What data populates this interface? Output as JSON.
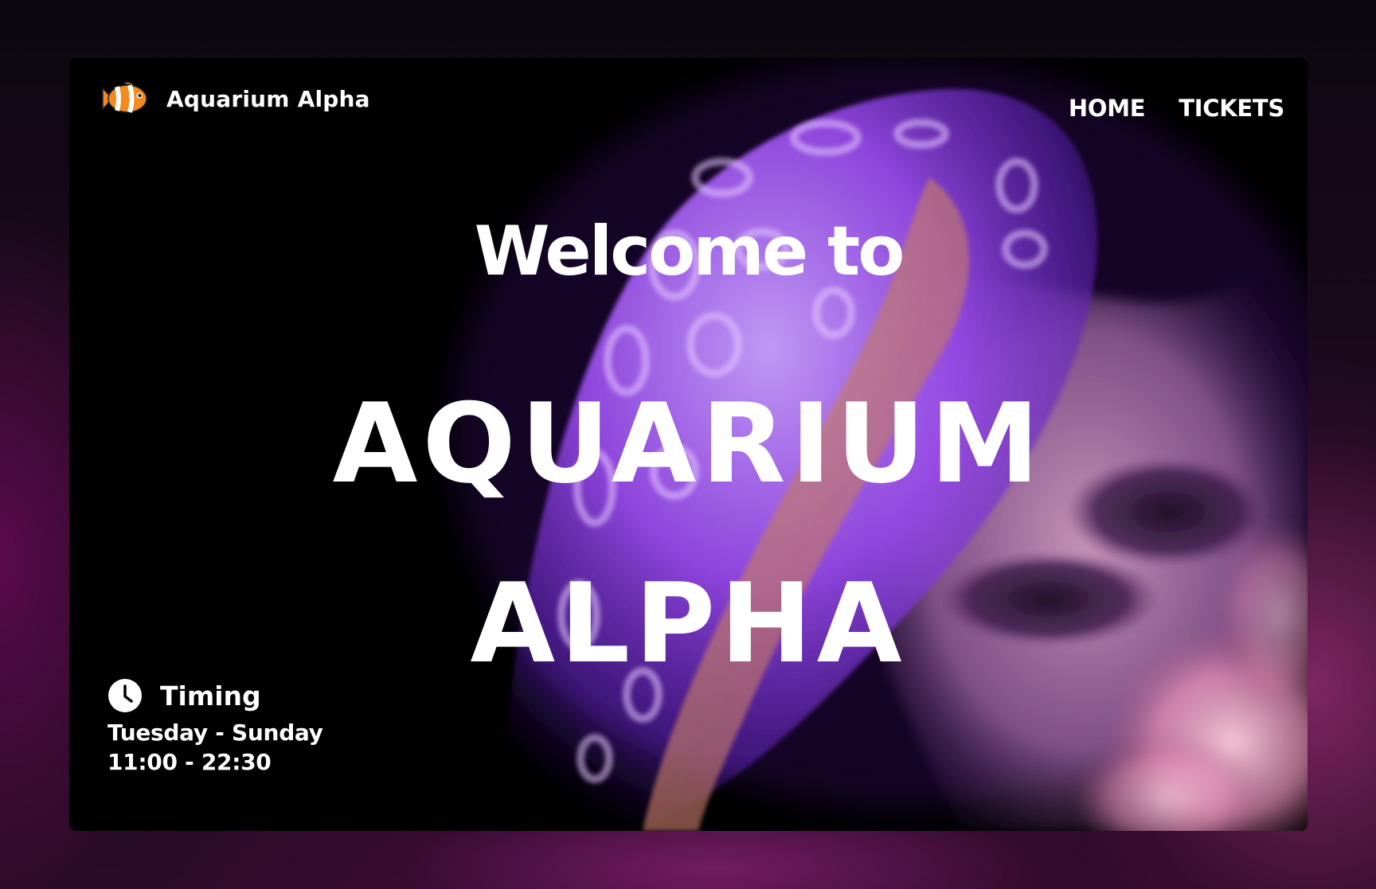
{
  "brand": {
    "name": "Aquarium Alpha",
    "logo_icon": "clownfish-icon"
  },
  "nav": {
    "items": [
      {
        "label": "HOME"
      },
      {
        "label": "TICKETS"
      }
    ]
  },
  "hero": {
    "welcome": "Welcome to",
    "title_line1": "AQUARIUM",
    "title_line2": "ALPHA"
  },
  "timing": {
    "icon": "clock-icon",
    "label": "Timing",
    "days": "Tuesday - Sunday",
    "hours": "11:00 - 22:30"
  },
  "colors": {
    "accent_purple": "#a855f7",
    "jelly_orange": "#c77a55",
    "text": "#ffffff",
    "card_bg": "#000000"
  }
}
